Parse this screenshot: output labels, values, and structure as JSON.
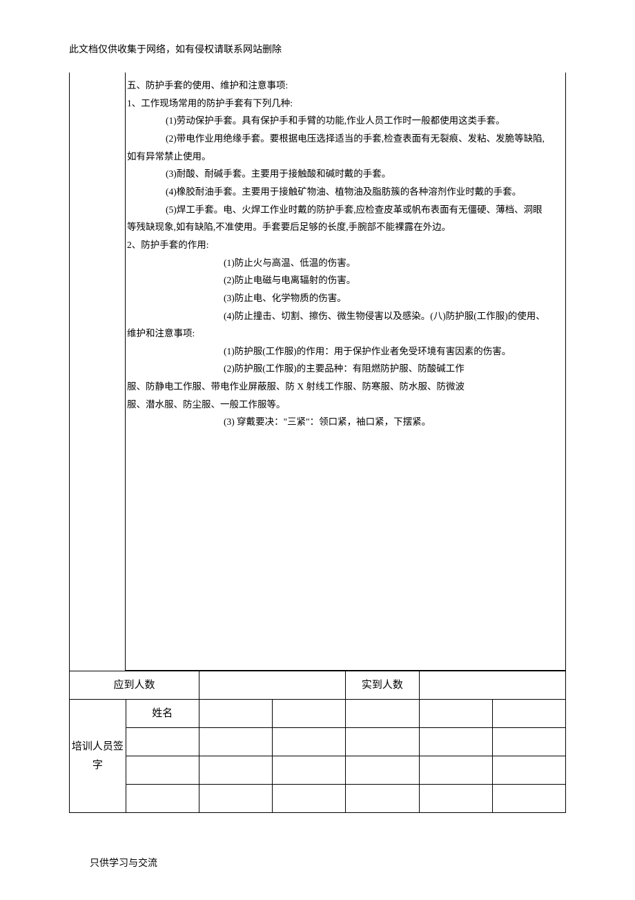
{
  "header": "此文档仅供收集于网络，如有侵权请联系网站删除",
  "footer": "只供学习与交流",
  "content": {
    "section5_title": "五、防护手套的使用、维护和注意事项:",
    "item1_title": "1、工作现场常用的防护手套有下列几种:",
    "item1_sub1": "(1)劳动保护手套。具有保护手和手臂的功能,作业人员工作时一般都使用这类手套。",
    "item1_sub2": "(2)带电作业用绝缘手套。要根据电压选择适当的手套,检查表面有无裂痕、发粘、发脆等缺陷,",
    "item1_sub2b": "如有异常禁止使用。",
    "item1_sub3": "(3)耐酸、耐碱手套。主要用于接触酸和碱时戴的手套。",
    "item1_sub4": "(4)橡胶耐油手套。主要用于接触矿物油、植物油及脂肪簇的各种溶剂作业时戴的手套。",
    "item1_sub5": "(5)焊工手套。电、火焊工作业时戴的防护手套,应检查皮革或帆布表面有无僵硬、薄档、洞眼",
    "item1_sub5b": "等残缺现象,如有缺陷,不准使用。手套要后足够的长度,手腕部不能裸露在外边。",
    "item2_title": "2、防护手套的作用:",
    "item2_sub1": "(1)防止火与高温、低温的伤害。",
    "item2_sub2": "(2)防止电磁与电离辐射的伤害。",
    "item2_sub3": "(3)防止电、化学物质的伤害。",
    "item2_sub4": "(4)防止撞击、切割、擦伤、微生物侵害以及感染。(八)防护服(工作服)的使用、",
    "item2_sub4b": "维护和注意事项:",
    "item3_sub1": "(1)防护服(工作服)的作用：用于保护作业者免受环境有害因素的伤害。",
    "item3_sub2": "(2)防护服(工作服)的主要品种：有阻燃防护服、防酸碱工作",
    "item3_sub2b": "服、防静电工作服、带电作业屏蔽服、防 X 射线工作服、防寒服、防水服、防微波",
    "item3_sub2c": "服、潜水服、防尘服、一般工作服等。",
    "item3_sub3": "(3) 穿戴要决：\"三紧\"：领口紧，袖口紧，下摆紧。"
  },
  "table": {
    "expected_label": "应到人数",
    "actual_label": "实到人数",
    "signature_label": "培训人员签字",
    "name_label": "姓名",
    "expected_value": "",
    "actual_value": ""
  }
}
